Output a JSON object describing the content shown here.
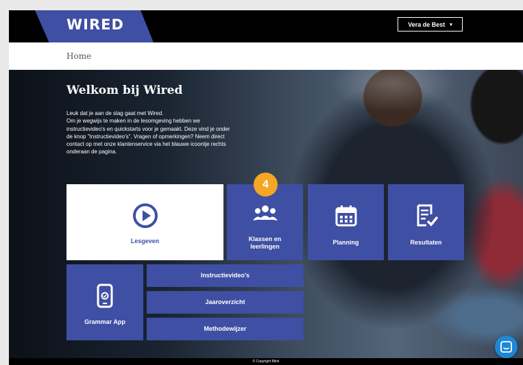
{
  "header": {
    "logo_text": "WIRED",
    "user_menu_label": "Vera de Best",
    "user_menu_caret": "▾"
  },
  "breadcrumb": {
    "home": "Home"
  },
  "hero": {
    "title": "Welkom bij Wired",
    "body_lines": [
      "Leuk dat je aan de slag gaat met Wired.",
      "Om je wegwijs te maken in de lesomgeving hebben we",
      "instructievideo's en quickstarts voor je gemaakt. Deze vind je onder",
      "de knop \"Instructievideo's\". Vragen of opmerkingen? Neem direct",
      "contact op met onze klantenservice via het blauwe icoontje rechts",
      "onderaan de pagina."
    ]
  },
  "tiles": {
    "lesgeven": "Lesgeven",
    "klassen_line1": "Klassen en",
    "klassen_line2": "leerlingen",
    "planning": "Planning",
    "resultaten": "Resultaten",
    "grammar_app": "Grammar App",
    "instructievideos": "Instructievideo's",
    "jaaroverzicht": "Jaaroverzicht",
    "methodewijzer": "Methodewijzer"
  },
  "badge": {
    "number": "4"
  },
  "footer": {
    "copyright": "© Copyright Blink"
  },
  "colors": {
    "brand_blue": "#3f4fa3",
    "badge_orange": "#f5a623",
    "chat_blue": "#1e88d6"
  },
  "icons": [
    "play-circle-icon",
    "users-icon",
    "calendar-icon",
    "clipboard-check-icon",
    "smartphone-icon",
    "chat-icon"
  ]
}
